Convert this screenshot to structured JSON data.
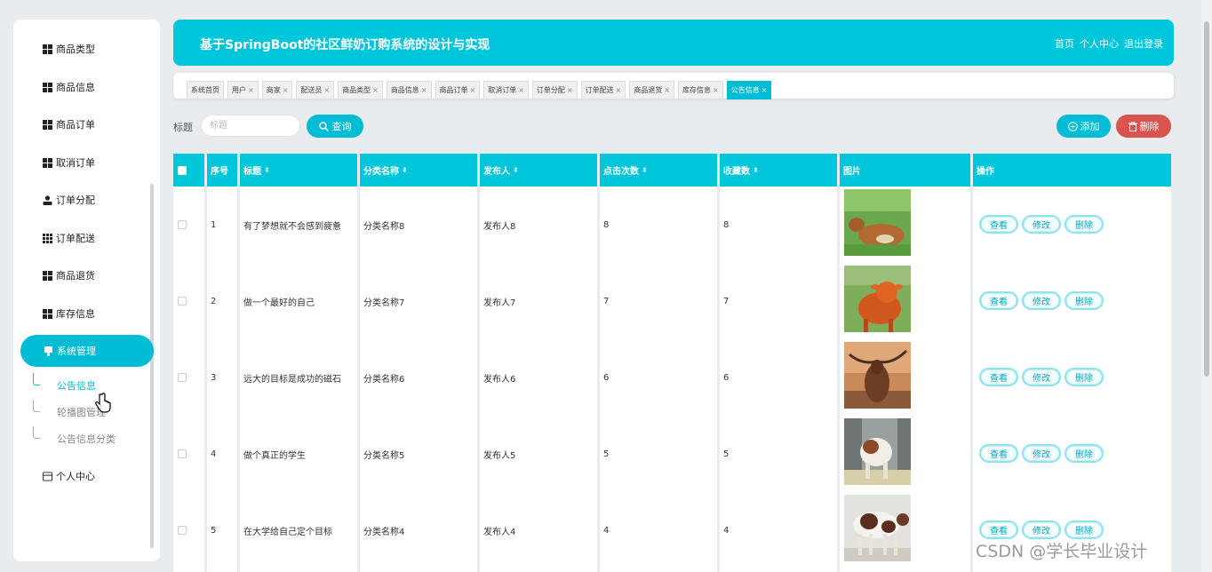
{
  "sidebar": {
    "items": [
      {
        "label": "商品类型",
        "icon": "grid-icon"
      },
      {
        "label": "商品信息",
        "icon": "grid-icon"
      },
      {
        "label": "商品订单",
        "icon": "grid-icon"
      },
      {
        "label": "取消订单",
        "icon": "grid-icon"
      },
      {
        "label": "订单分配",
        "icon": "user-icon"
      },
      {
        "label": "订单配送",
        "icon": "table-icon"
      },
      {
        "label": "商品退货",
        "icon": "grid-icon"
      },
      {
        "label": "库存信息",
        "icon": "grid-icon"
      },
      {
        "label": "系统管理",
        "icon": "gift-icon"
      }
    ],
    "sub_items": [
      "公告信息",
      "轮播图管理",
      "公告信息分类"
    ],
    "last_item": {
      "label": "个人中心",
      "icon": "card-icon"
    }
  },
  "header": {
    "title": "基于SpringBoot的社区鲜奶订购系统的设计与实现",
    "links": [
      "首页",
      "个人中心",
      "退出登录"
    ]
  },
  "tabs": [
    "系统首页",
    "用户",
    "商家",
    "配送员",
    "商品类型",
    "商品信息",
    "商品订单",
    "取消订单",
    "订单分配",
    "订单配送",
    "商品退货",
    "库存信息",
    "公告信息"
  ],
  "search": {
    "label": "标题",
    "placeholder": "标题",
    "query_label": "查询"
  },
  "actions": {
    "add_label": "添加",
    "delete_label": "删除"
  },
  "table": {
    "columns": [
      "序号",
      "标题",
      "分类名称",
      "发布人",
      "点击次数",
      "收藏数",
      "图片",
      "操作"
    ],
    "rows": [
      {
        "idx": "1",
        "title": "有了梦想就不会感到疲惫",
        "category": "分类名称8",
        "publisher": "发布人8",
        "clicks": "8",
        "favorites": "8"
      },
      {
        "idx": "2",
        "title": "做一个最好的自己",
        "category": "分类名称7",
        "publisher": "发布人7",
        "clicks": "7",
        "favorites": "7"
      },
      {
        "idx": "3",
        "title": "远大的目标是成功的磁石",
        "category": "分类名称6",
        "publisher": "发布人6",
        "clicks": "6",
        "favorites": "6"
      },
      {
        "idx": "4",
        "title": "做个真正的学生",
        "category": "分类名称5",
        "publisher": "发布人5",
        "clicks": "5",
        "favorites": "5"
      },
      {
        "idx": "5",
        "title": "在大学给自己定个目标",
        "category": "分类名称4",
        "publisher": "发布人4",
        "clicks": "4",
        "favorites": "4"
      }
    ],
    "ops": [
      "查看",
      "修改",
      "删除"
    ]
  },
  "watermark": "CSDN @学长毕业设计",
  "colors": {
    "accent": "#00bcd4",
    "danger": "#d9534f",
    "background": "#e9ecef"
  }
}
